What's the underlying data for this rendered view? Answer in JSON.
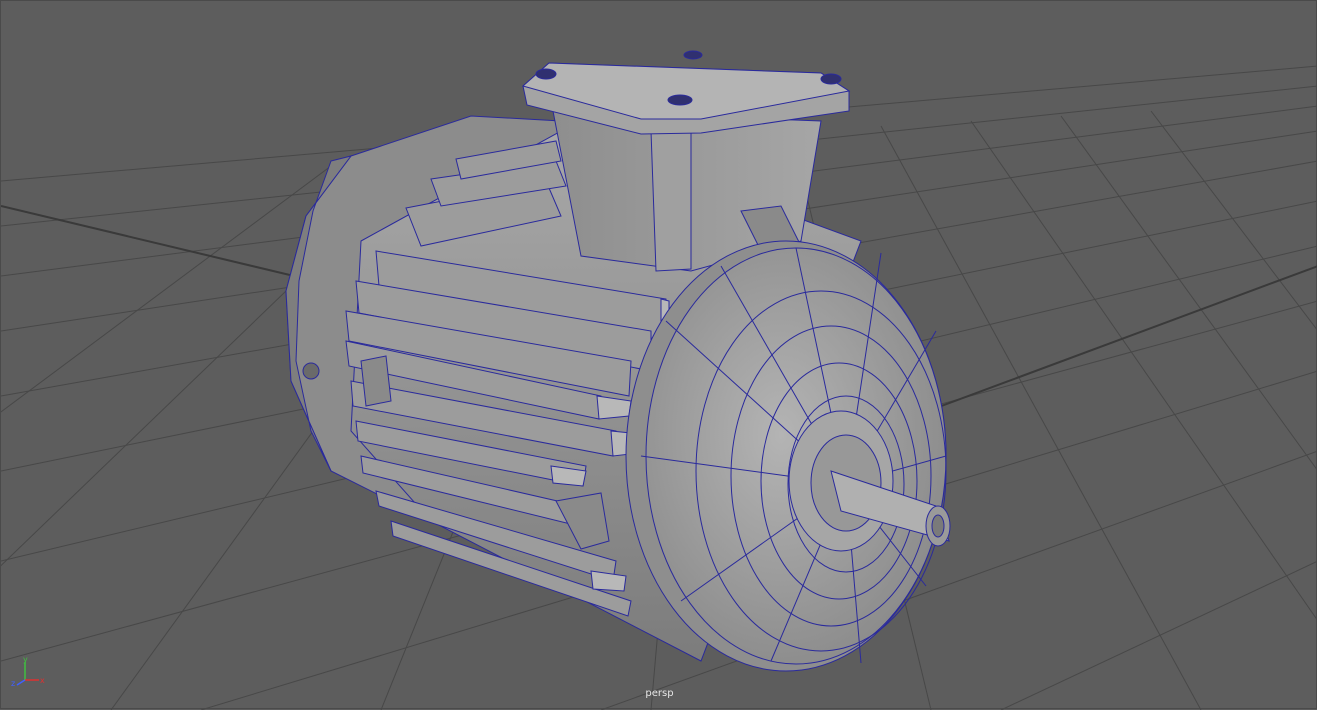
{
  "viewport": {
    "camera_name": "persp",
    "background": "#5d5d5d",
    "grid_color": "#484848",
    "grid_axis_color": "#3a3a3a",
    "wire_color": "#2a2a9c",
    "model_name": "electric-motor"
  },
  "axis_gizmo": {
    "x_label": "x",
    "y_label": "y",
    "z_label": "z",
    "x_color": "#e03030",
    "y_color": "#40c040",
    "z_color": "#4060ff"
  }
}
